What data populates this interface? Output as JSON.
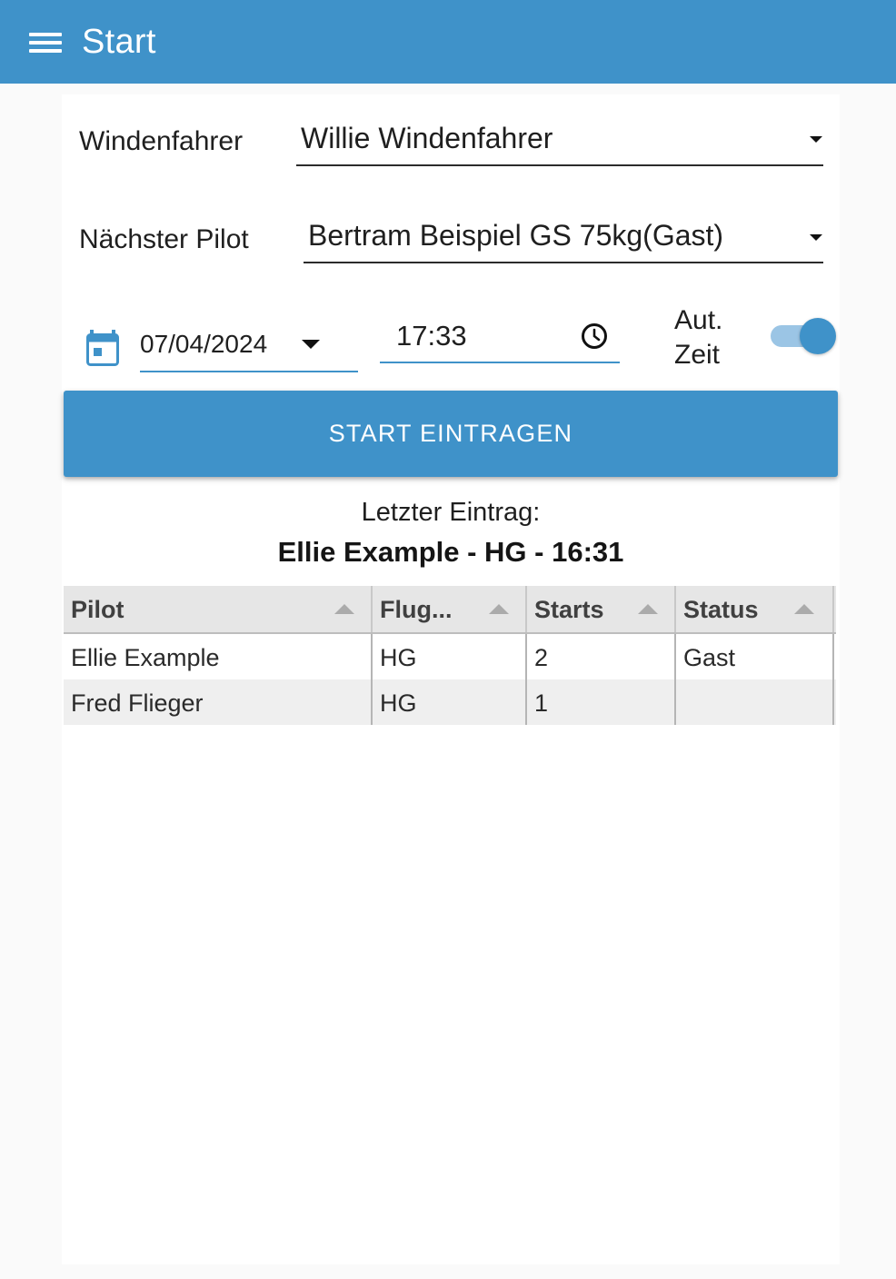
{
  "appbar": {
    "title": "Start",
    "color": "#3f92c9"
  },
  "form": {
    "winch_label": "Windenfahrer",
    "winch_value": "Willie Windenfahrer",
    "pilot_label": "Nächster Pilot",
    "pilot_value": "Bertram Beispiel GS 75kg(Gast)",
    "date_value": "07/04/2024",
    "time_value": "17:33",
    "auto_time_label_1": "Aut.",
    "auto_time_label_2": "Zeit",
    "auto_time_on": true,
    "submit_label": "START EINTRAGEN"
  },
  "last_entry": {
    "label": "Letzter Eintrag:",
    "value": "Ellie Example - HG - 16:31"
  },
  "table": {
    "columns": [
      "Pilot",
      "Flug...",
      "Starts",
      "Status"
    ],
    "rows": [
      [
        "Ellie Example",
        "HG",
        "2",
        "Gast"
      ],
      [
        "Fred Flieger",
        "HG",
        "1",
        ""
      ]
    ]
  }
}
